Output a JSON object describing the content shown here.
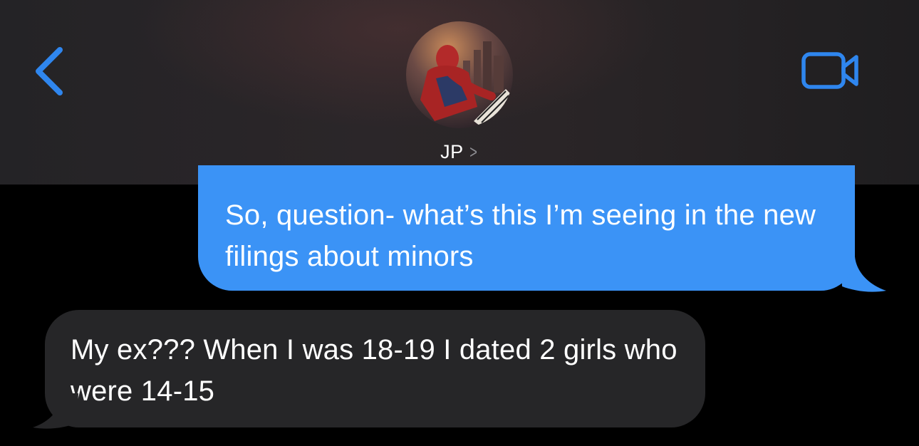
{
  "header": {
    "contact_name": "JP",
    "contact_chevron": ">",
    "back_icon": "chevron-left-icon",
    "video_icon": "video-camera-icon",
    "accent_color": "#2f86ee"
  },
  "messages": [
    {
      "direction": "outgoing",
      "text": "So, question- what’s this I’m seeing in the new filings about minors",
      "bubble_color": "#3b93f6"
    },
    {
      "direction": "incoming",
      "text": "My ex??? When I was 18-19 I dated 2 girls who were 14-15",
      "bubble_color": "#262628"
    }
  ]
}
